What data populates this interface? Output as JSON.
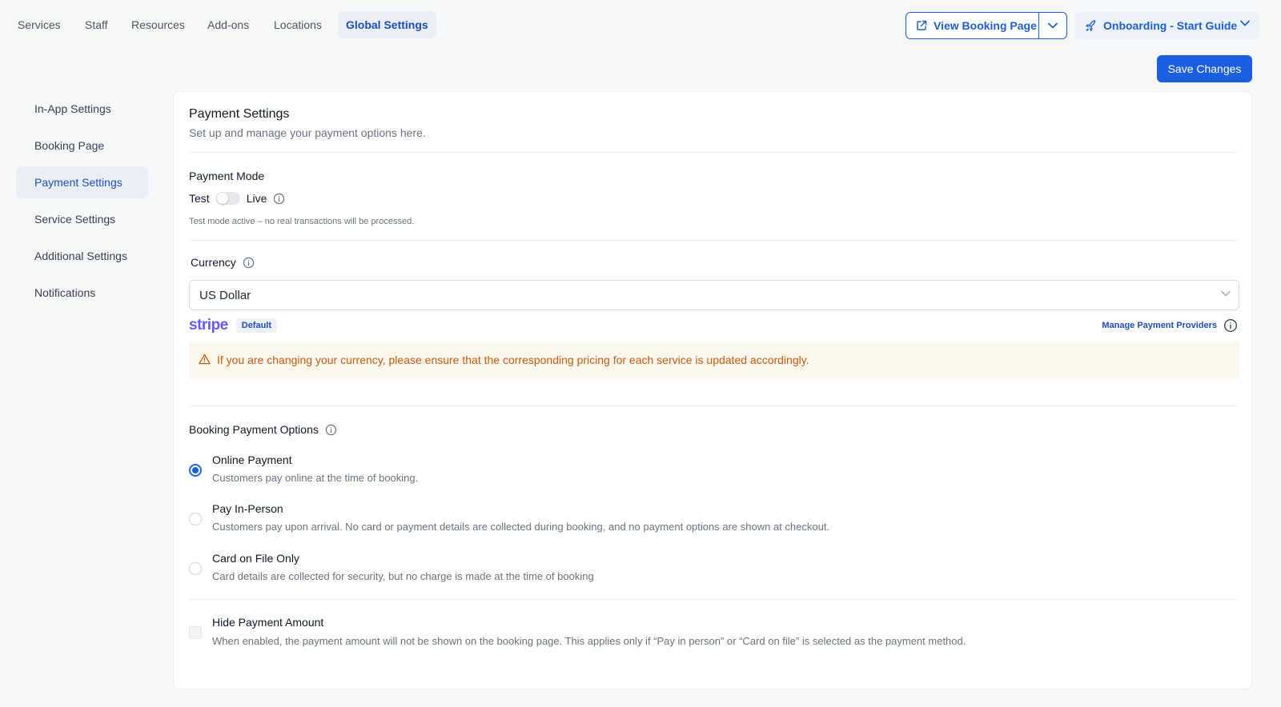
{
  "nav": {
    "tabs": [
      {
        "label": "Services"
      },
      {
        "label": "Staff"
      },
      {
        "label": "Resources"
      },
      {
        "label": "Add-ons"
      },
      {
        "label": "Locations"
      },
      {
        "label": "Global Settings"
      }
    ],
    "view_booking_label": "View Booking Page",
    "onboarding_label": "Onboarding - Start Guide",
    "save_label": "Save Changes"
  },
  "sidebar": {
    "items": [
      {
        "label": "In-App Settings"
      },
      {
        "label": "Booking Page"
      },
      {
        "label": "Payment Settings"
      },
      {
        "label": "Service Settings"
      },
      {
        "label": "Additional Settings"
      },
      {
        "label": "Notifications"
      }
    ],
    "active": "Payment Settings"
  },
  "main": {
    "title": "Payment Settings",
    "subtitle": "Set up and manage your payment options here.",
    "payment_mode": {
      "label": "Payment Mode",
      "left": "Test",
      "right": "Live",
      "note": "Test mode active – no real transactions will be processed."
    },
    "currency": {
      "label": "Currency",
      "value": "US Dollar",
      "provider": "stripe",
      "default_badge": "Default",
      "manage_link": "Manage Payment Providers",
      "warning": "If you are changing your currency, please ensure that the corresponding pricing for each service is updated accordingly."
    },
    "booking_options": {
      "label": "Booking Payment Options",
      "options": [
        {
          "title": "Online Payment",
          "desc": "Customers pay online at the time of booking.",
          "checked": true
        },
        {
          "title": "Pay In-Person",
          "desc": "Customers pay upon arrival. No card or payment details are collected during booking, and no payment options are shown at checkout.",
          "checked": false
        },
        {
          "title": "Card on File Only",
          "desc": "Card details are collected for security, but no charge is made at the time of booking",
          "checked": false
        }
      ]
    },
    "hide_amount": {
      "title": "Hide Payment Amount",
      "desc": "When enabled, the payment amount will not be shown on the booking page. This applies only if “Pay in person” or “Card on file” is selected as the payment method.",
      "checked": false
    }
  },
  "colors": {
    "accent": "#1a5fe0",
    "warning_text": "#c55a11",
    "warning_bg": "#fdf8ee",
    "stripe": "#635bff"
  }
}
